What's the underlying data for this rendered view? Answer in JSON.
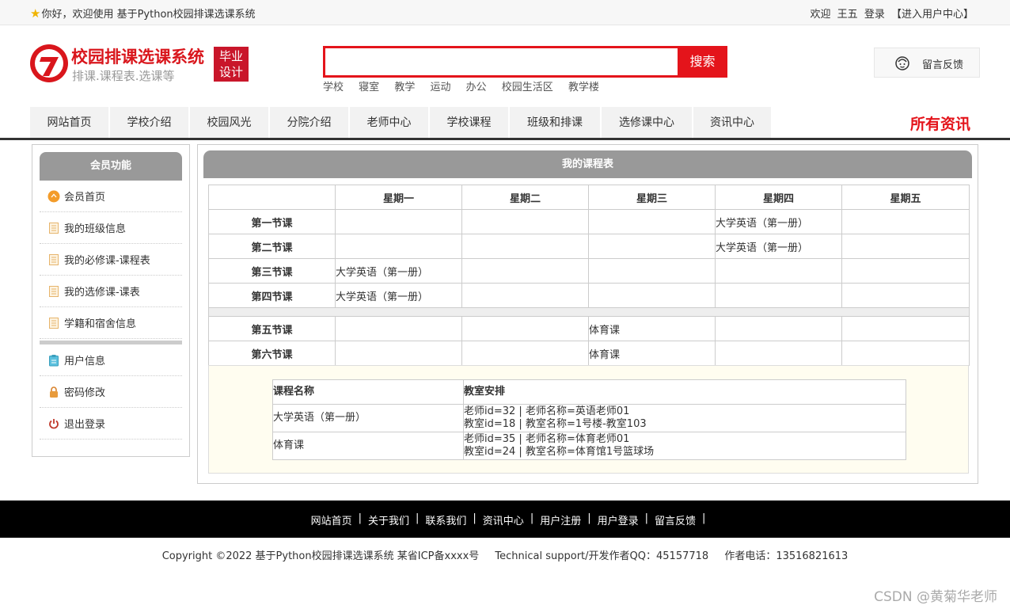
{
  "topbar": {
    "welcome": "你好，欢迎使用 基于Python校园排课选课系统",
    "greeting": "欢迎",
    "username": "王五",
    "login": "登录",
    "user_center": "【进入用户中心】"
  },
  "logo": {
    "title": "校园排课选课系统",
    "subtitle": "排课.课程表.选课等",
    "badge_line1": "毕业",
    "badge_line2": "设计"
  },
  "search": {
    "value": "",
    "button": "搜索",
    "hotwords": [
      "学校",
      "寝室",
      "教学",
      "运动",
      "办公",
      "校园生活区",
      "教学楼"
    ]
  },
  "feedback": {
    "label": "留言反馈"
  },
  "nav": {
    "items": [
      "网站首页",
      "学校介绍",
      "校园风光",
      "分院介绍",
      "老师中心",
      "学校课程",
      "班级和排课",
      "选修课中心",
      "资讯中心"
    ],
    "all_news": "所有资讯"
  },
  "sidebar": {
    "title": "会员功能",
    "items": [
      "会员首页",
      "我的班级信息",
      "我的必修课-课程表",
      "我的选修课-课表",
      "学籍和宿舍信息"
    ],
    "items2": [
      "用户信息",
      "密码修改",
      "退出登录"
    ]
  },
  "schedule": {
    "title": "我的课程表",
    "days": [
      "星期一",
      "星期二",
      "星期三",
      "星期四",
      "星期五"
    ],
    "rows": [
      {
        "label": "第一节课",
        "cells": [
          "",
          "",
          "",
          "大学英语（第一册）",
          ""
        ]
      },
      {
        "label": "第二节课",
        "cells": [
          "",
          "",
          "",
          "大学英语（第一册）",
          ""
        ]
      },
      {
        "label": "第三节课",
        "cells": [
          "大学英语（第一册）",
          "",
          "",
          "",
          ""
        ]
      },
      {
        "label": "第四节课",
        "cells": [
          "大学英语（第一册）",
          "",
          "",
          "",
          ""
        ]
      },
      {
        "label": "第五节课",
        "cells": [
          "",
          "",
          "体育课",
          "",
          ""
        ]
      },
      {
        "label": "第六节课",
        "cells": [
          "",
          "",
          "体育课",
          "",
          ""
        ]
      }
    ]
  },
  "details": {
    "headers": [
      "课程名称",
      "教室安排"
    ],
    "rows": [
      {
        "name": "大学英语（第一册）",
        "line1": "老师id=32 | 老师名称=英语老师01",
        "line2": "教室id=18 | 教室名称=1号楼-教室103"
      },
      {
        "name": "体育课",
        "line1": "老师id=35 | 老师名称=体育老师01",
        "line2": "教室id=24 | 教室名称=体育馆1号篮球场"
      }
    ]
  },
  "footer": {
    "links": [
      "网站首页",
      "关于我们",
      "联系我们",
      "资讯中心",
      "用户注册",
      "用户登录",
      "留言反馈"
    ],
    "separator": "|",
    "copyright": "Copyright ©2022 基于Python校园排课选课系统 某省ICP备xxxx号",
    "support": "Technical support/开发作者QQ：45157718",
    "phone": "作者电话：13516821613"
  },
  "watermark": "CSDN @黄菊华老师",
  "colors": {
    "accent": "#e4141b",
    "nav_bg": "#f2f2f2",
    "header_gray": "#999999",
    "footer_bg": "#000000"
  }
}
